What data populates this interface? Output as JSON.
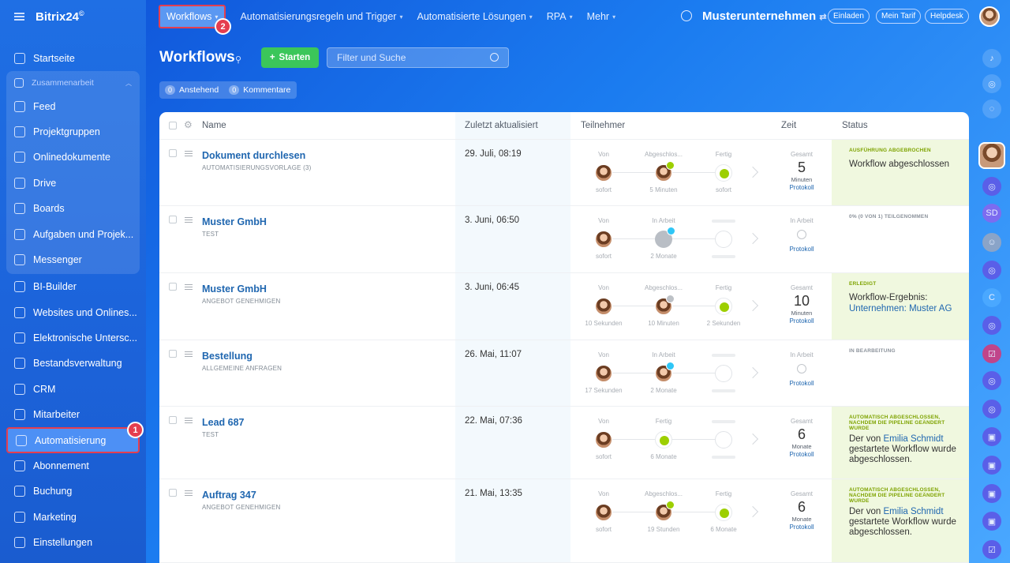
{
  "app": {
    "logo": "Bitrix24",
    "logo_mark": "©"
  },
  "sidebar": {
    "items": [
      {
        "label": "Startseite",
        "icon": "home-icon"
      },
      {
        "label": "Zusammenarbeit",
        "icon": "group-icon"
      },
      {
        "label": "Feed",
        "icon": "feed-icon"
      },
      {
        "label": "Projektgruppen",
        "icon": "users-icon"
      },
      {
        "label": "Onlinedokumente",
        "icon": "document-icon"
      },
      {
        "label": "Drive",
        "icon": "drive-icon"
      },
      {
        "label": "Boards",
        "icon": "board-icon"
      },
      {
        "label": "Aufgaben und Projek...",
        "icon": "task-icon"
      },
      {
        "label": "Messenger",
        "icon": "chat-icon"
      },
      {
        "label": "BI-Builder",
        "icon": "chart-icon"
      },
      {
        "label": "Websites und Onlines...",
        "icon": "cart-icon"
      },
      {
        "label": "Elektronische Untersc...",
        "icon": "signature-icon"
      },
      {
        "label": "Bestandsverwaltung",
        "icon": "inventory-icon"
      },
      {
        "label": "CRM",
        "icon": "crm-icon"
      },
      {
        "label": "Mitarbeiter",
        "icon": "employee-icon"
      },
      {
        "label": "Automatisierung",
        "icon": "robot-icon"
      },
      {
        "label": "Abonnement",
        "icon": "subscription-icon"
      },
      {
        "label": "Buchung",
        "icon": "calendar-icon"
      },
      {
        "label": "Marketing",
        "icon": "marketing-icon"
      },
      {
        "label": "Einstellungen",
        "icon": "gear-icon"
      }
    ]
  },
  "topnav": {
    "items": [
      "Workflows",
      "Automatisierungsregeln und Trigger",
      "Automatisierte Lösungen",
      "RPA",
      "Mehr"
    ],
    "company": "Musterunternehmen",
    "buttons": [
      "Einladen",
      "Mein Tarif",
      "Helpdesk"
    ]
  },
  "markers": {
    "one": "1",
    "two": "2"
  },
  "page": {
    "title": "Workflows",
    "start_button": "Starten",
    "filter_placeholder": "Filter und Suche",
    "counters": [
      {
        "count": "0",
        "label": "Anstehend"
      },
      {
        "count": "0",
        "label": "Kommentare"
      }
    ]
  },
  "grid": {
    "columns": [
      "Name",
      "Zuletzt aktualisiert",
      "Teilnehmer",
      "Zeit",
      "Status"
    ],
    "rows": [
      {
        "name": "Dokument durchlesen",
        "sub": "AUTOMATISIERUNGSVORLAGE (3)",
        "date": "29. Juli, 08:19",
        "steps": [
          {
            "label": "Von",
            "bottom": "sofort"
          },
          {
            "label": "Abgeschlos...",
            "bottom": "5 Minuten"
          },
          {
            "label": "Fertig",
            "bottom": "sofort"
          }
        ],
        "time_label": "Gesamt",
        "time_value": "5",
        "time_unit": "Minuten",
        "protocol": "Protokoll",
        "status_caption": "AUSFÜHRUNG ABGEBROCHEN",
        "status_text": "Workflow abgeschlossen",
        "status_link": ""
      },
      {
        "name": "Muster GmbH",
        "sub": "TEST",
        "date": "3. Juni, 06:50",
        "steps": [
          {
            "label": "Von",
            "bottom": "sofort"
          },
          {
            "label": "In Arbeit",
            "bottom": "2 Monate"
          },
          {
            "label": "",
            "bottom": ""
          }
        ],
        "time_label": "In Arbeit",
        "time_value": "",
        "time_unit": "",
        "protocol": "Protokoll",
        "status_caption": "0% (0 VON 1) TEILGENOMMEN",
        "status_text": "",
        "status_link": ""
      },
      {
        "name": "Muster GmbH",
        "sub": "ANGEBOT GENEHMIGEN",
        "date": "3. Juni, 06:45",
        "steps": [
          {
            "label": "Von",
            "bottom": "10 Sekunden"
          },
          {
            "label": "Abgeschlos...",
            "bottom": "10 Minuten"
          },
          {
            "label": "Fertig",
            "bottom": "2 Sekunden"
          }
        ],
        "time_label": "Gesamt",
        "time_value": "10",
        "time_unit": "Minuten",
        "protocol": "Protokoll",
        "status_caption": "ERLEDIGT",
        "status_text": "Workflow-Ergebnis:",
        "status_link": "Unternehmen: Muster AG"
      },
      {
        "name": "Bestellung",
        "sub": "ALLGEMEINE ANFRAGEN",
        "date": "26. Mai, 11:07",
        "steps": [
          {
            "label": "Von",
            "bottom": "17 Sekunden"
          },
          {
            "label": "In Arbeit",
            "bottom": "2 Monate"
          },
          {
            "label": "",
            "bottom": ""
          }
        ],
        "time_label": "In Arbeit",
        "time_value": "",
        "time_unit": "",
        "protocol": "Protokoll",
        "status_caption": "IN BEARBEITUNG",
        "status_text": "",
        "status_link": ""
      },
      {
        "name": "Lead 687",
        "sub": "TEST",
        "date": "22. Mai, 07:36",
        "steps": [
          {
            "label": "Von",
            "bottom": "sofort"
          },
          {
            "label": "Fertig",
            "bottom": "6 Monate"
          },
          {
            "label": "",
            "bottom": ""
          }
        ],
        "time_label": "Gesamt",
        "time_value": "6",
        "time_unit": "Monate",
        "protocol": "Protokoll",
        "status_caption": "AUTOMATISCH ABGESCHLOSSEN, NACHDEM DIE PIPELINE GEÄNDERT WURDE",
        "status_pre": "Der von ",
        "status_link": "Emilia Schmidt",
        "status_text": "gestartete Workflow wurde abgeschlossen."
      },
      {
        "name": "Auftrag 347",
        "sub": "ANGEBOT GENEHMIGEN",
        "date": "21. Mai, 13:35",
        "steps": [
          {
            "label": "Von",
            "bottom": "sofort"
          },
          {
            "label": "Abgeschlos...",
            "bottom": "19 Stunden"
          },
          {
            "label": "Fertig",
            "bottom": "6 Monate"
          }
        ],
        "time_label": "Gesamt",
        "time_value": "6",
        "time_unit": "Monate",
        "protocol": "Protokoll",
        "status_caption": "AUTOMATISCH ABGESCHLOSSEN, NACHDEM DIE PIPELINE GEÄNDERT WURDE",
        "status_pre": "Der von ",
        "status_link": "Emilia Schmidt",
        "status_text": "gestartete Workflow wurde abgeschlossen."
      }
    ]
  },
  "rightbar": {
    "icons": [
      "bell-icon",
      "widget-icon",
      "chat-icon",
      "avatar",
      "copilot-icon",
      "sd-avatar",
      "user-avatar",
      "copilot-icon",
      "c-avatar",
      "copilot-icon",
      "task-icon",
      "copilot-icon",
      "copilot-icon",
      "lock-icon",
      "lock-icon",
      "lock-icon",
      "lock-icon",
      "check-icon"
    ],
    "sd": "SD",
    "c": "C"
  }
}
